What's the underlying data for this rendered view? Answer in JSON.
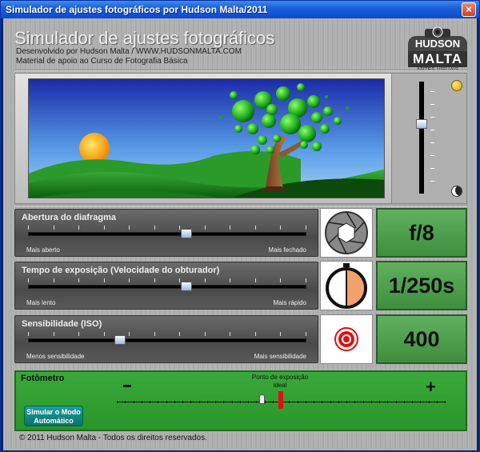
{
  "window": {
    "title": "Simulador de ajustes fotográficos por Hudson Malta/2011",
    "close_glyph": "×"
  },
  "header": {
    "title": "Simulador de ajustes fotográficos",
    "line1": "Desenvolvido por Hudson Malta / WWW.HUDSONMALTA.COM",
    "line2": "Material de apoio ao Curso de Fotografia  Básica"
  },
  "logo": {
    "line1": "HUDSON",
    "line2": "MALTA",
    "line3": "ARTES VISUAIS"
  },
  "light": {
    "level": 0.38,
    "sun_icon": "sun-icon",
    "moon_icon": "moon-icon"
  },
  "controls": [
    {
      "label": "Abertura do diafragma",
      "min": "Mais aberto",
      "max": "Mais fechado",
      "position": 0.57,
      "value": "f/8",
      "icon": "aperture-icon"
    },
    {
      "label": "Tempo de exposição (Velocidade do obturador)",
      "min": "Mais lento",
      "max": "Mais rápido",
      "position": 0.57,
      "value": "1/250s",
      "icon": "stopwatch-icon"
    },
    {
      "label": "Sensibilidade (ISO)",
      "min": "Menos sensibilidade",
      "max": "Mais sensibilidade",
      "position": 0.33,
      "value": "400",
      "icon": "iso-target-icon"
    }
  ],
  "meter": {
    "title": "Fotômetro",
    "ideal_label": "Ponto de exposição ideal",
    "minus": "−",
    "plus": "+",
    "auto_button": "Simular o Modo Automático"
  },
  "footer": "© 2011 Hudson Malta  -  Todos os direitos reservados."
}
